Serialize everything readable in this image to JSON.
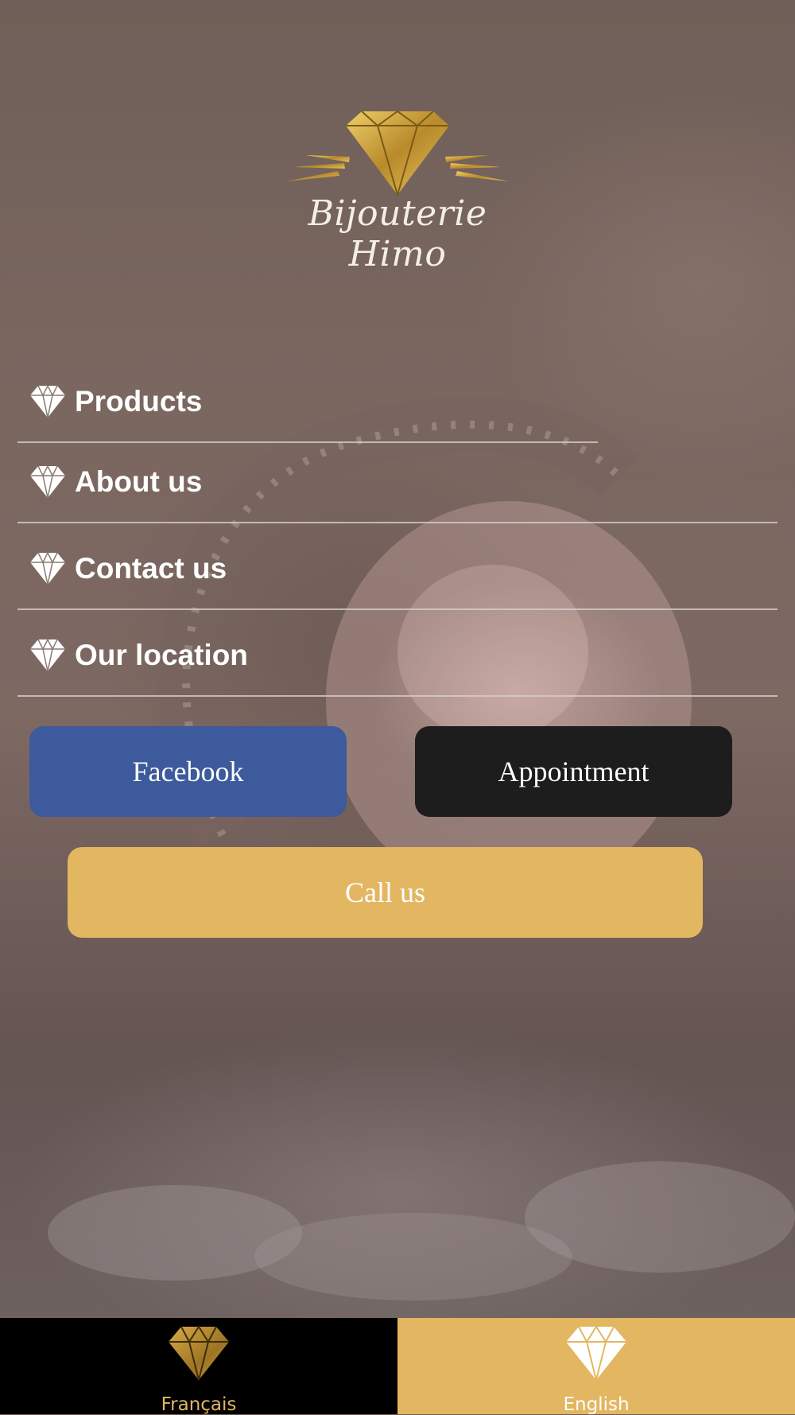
{
  "brand": {
    "name": "Bijouterie Himo",
    "logo_icon": "diamond-logo-icon"
  },
  "menu": {
    "items": [
      {
        "label": "Products",
        "icon": "diamond-icon"
      },
      {
        "label": "About us",
        "icon": "diamond-icon"
      },
      {
        "label": "Contact us",
        "icon": "diamond-icon"
      },
      {
        "label": "Our location",
        "icon": "diamond-icon"
      }
    ]
  },
  "actions": {
    "facebook_label": "Facebook",
    "appointment_label": "Appointment",
    "call_label": "Call us"
  },
  "tabbar": {
    "tabs": [
      {
        "label": "Français",
        "icon": "diamond-icon",
        "selected": false
      },
      {
        "label": "English",
        "icon": "diamond-icon",
        "selected": true
      }
    ]
  },
  "colors": {
    "gold": "#e3b661",
    "facebook": "#3c5a9c",
    "dark": "#1d1d1d",
    "tab_dark": "#000000"
  }
}
